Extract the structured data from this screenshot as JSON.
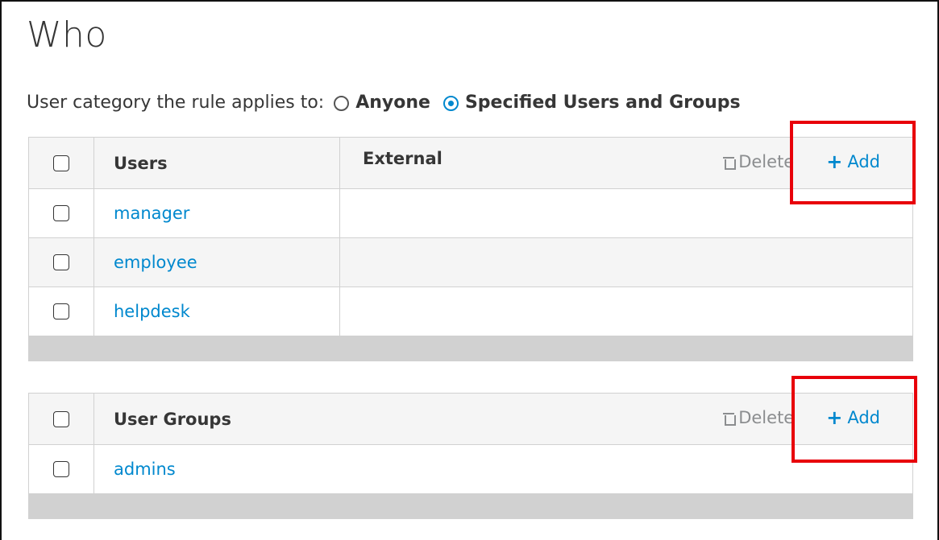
{
  "title": "Who",
  "category": {
    "label": "User category the rule applies to:",
    "options": [
      {
        "label": "Anyone",
        "selected": false
      },
      {
        "label": "Specified Users and Groups",
        "selected": true
      }
    ]
  },
  "users_table": {
    "col_users": "Users",
    "col_external": "External",
    "delete_label": "Delete",
    "add_label": "Add",
    "rows": [
      "manager",
      "employee",
      "helpdesk"
    ]
  },
  "groups_table": {
    "col_groups": "User Groups",
    "delete_label": "Delete",
    "add_label": "Add",
    "rows": [
      "admins"
    ]
  },
  "colors": {
    "link": "#0088ce",
    "highlight": "#e8000a",
    "muted": "#8b8d8f"
  },
  "icons": [
    "trash-icon",
    "plus-icon",
    "checkbox-icon",
    "radio-icon"
  ]
}
